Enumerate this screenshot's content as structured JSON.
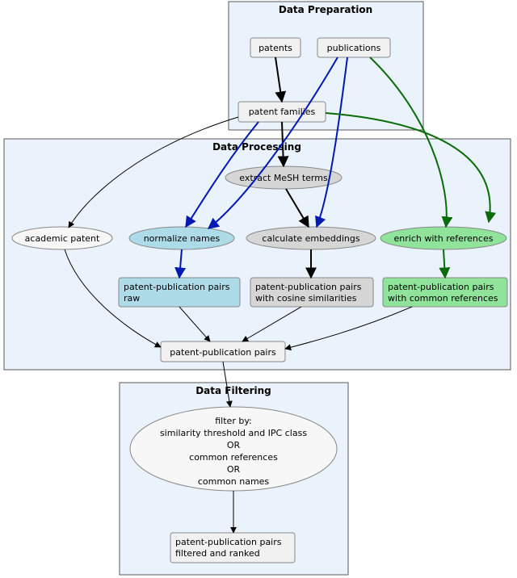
{
  "groups": {
    "prep": {
      "title": "Data Preparation"
    },
    "proc": {
      "title": "Data Processing"
    },
    "filt": {
      "title": "Data Filtering"
    }
  },
  "nodes": {
    "patents": "patents",
    "publications": "publications",
    "patent_families": "patent families",
    "extract_mesh": "extract MeSH terms",
    "academic_patent": "academic patent",
    "normalize_names": "normalize names",
    "calculate_embeddings": "calculate embeddings",
    "enrich_refs": "enrich with references",
    "pp_raw_l1": "patent-publication pairs",
    "pp_raw_l2": "raw",
    "pp_cos_l1": "patent-publication pairs",
    "pp_cos_l2": "with cosine similarities",
    "pp_ref_l1": "patent-publication pairs",
    "pp_ref_l2": "with common references",
    "pp_pairs": "patent-publication pairs",
    "filter_l1": "filter by:",
    "filter_l2": "similarity threshold and IPC class",
    "filter_l3": "OR",
    "filter_l4": "common references",
    "filter_l5": "OR",
    "filter_l6": "common names",
    "pp_filtered_l1": "patent-publication pairs",
    "pp_filtered_l2": "filtered and ranked"
  }
}
